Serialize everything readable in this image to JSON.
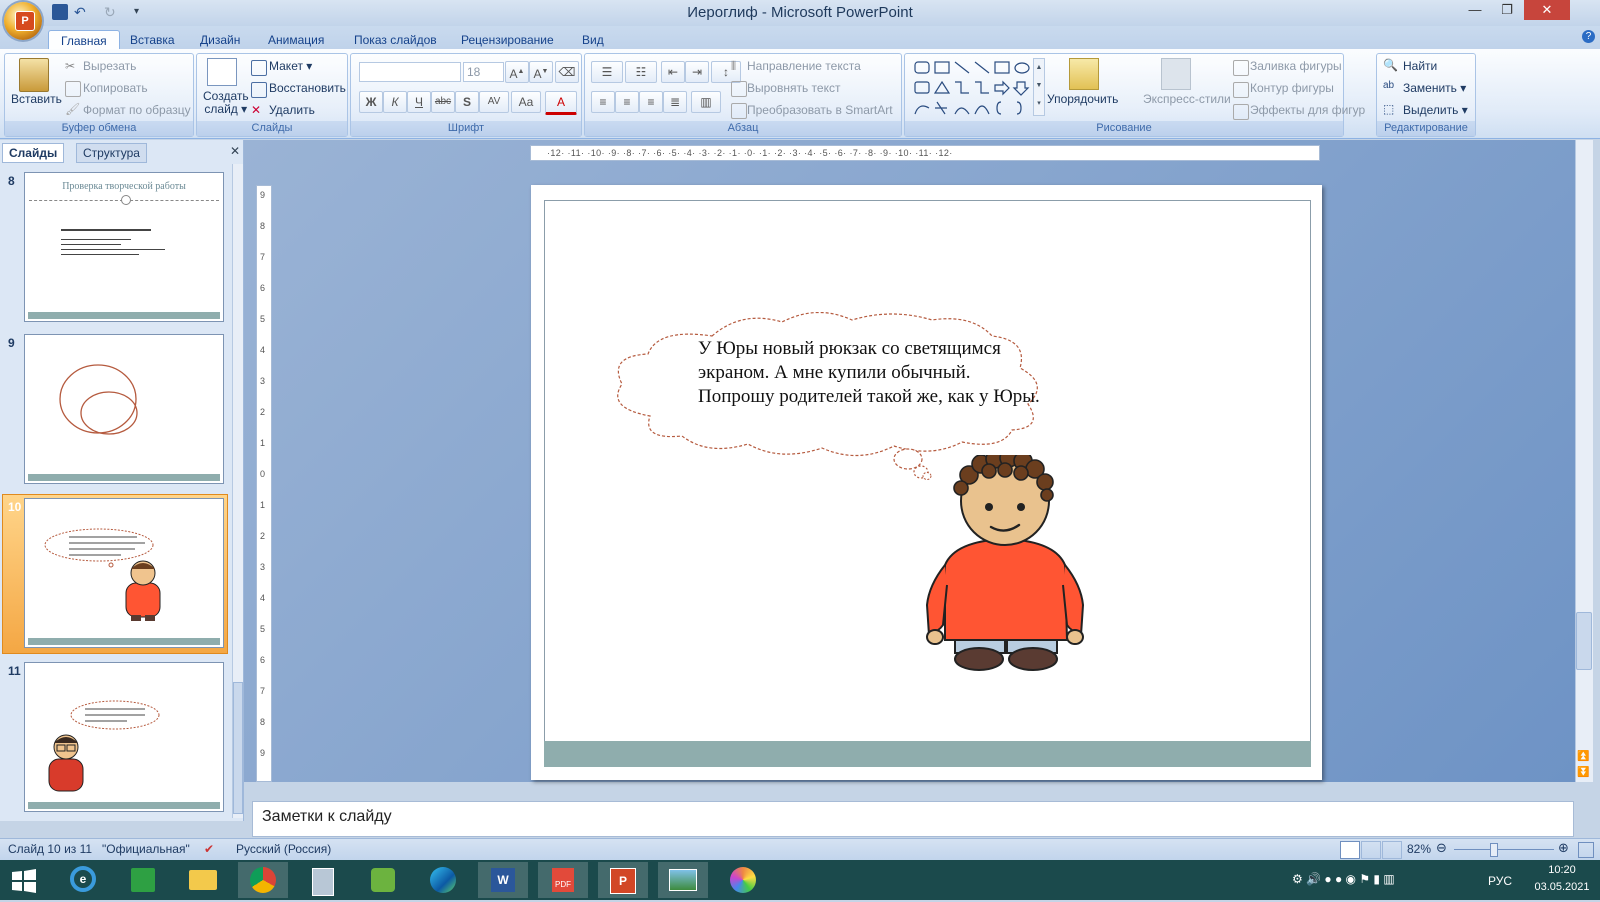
{
  "window": {
    "title": "Иероглиф - Microsoft PowerPoint"
  },
  "tabs": [
    "Главная",
    "Вставка",
    "Дизайн",
    "Анимация",
    "Показ слайдов",
    "Рецензирование",
    "Вид"
  ],
  "ribbon": {
    "clipboard": {
      "label": "Буфер обмена",
      "paste": "Вставить",
      "cut": "Вырезать",
      "copy": "Копировать",
      "format_painter": "Формат по образцу"
    },
    "slides": {
      "label": "Слайды",
      "new_slide_line1": "Создать",
      "new_slide_line2": "слайд",
      "layout": "Макет",
      "reset": "Восстановить",
      "delete": "Удалить"
    },
    "font": {
      "label": "Шрифт",
      "size": "18",
      "bold": "Ж",
      "italic": "К",
      "underline": "Ч",
      "strike": "abc",
      "shadow": "S",
      "spacing": "AV",
      "case": "Aa",
      "color": "A"
    },
    "paragraph": {
      "label": "Абзац",
      "text_direction": "Направление текста",
      "align_text": "Выровнять текст",
      "smartart": "Преобразовать в SmartArt"
    },
    "drawing": {
      "label": "Рисование",
      "arrange": "Упорядочить",
      "quick_styles": "Экспресс-стили",
      "fill": "Заливка фигуры",
      "outline": "Контур фигуры",
      "effects": "Эффекты для фигур"
    },
    "editing": {
      "label": "Редактирование",
      "find": "Найти",
      "replace": "Заменить",
      "select": "Выделить"
    }
  },
  "left_panel": {
    "tab_slides": "Слайды",
    "tab_outline": "Структура",
    "thumbs": [
      {
        "num": "8",
        "title": "Проверка творческой работы"
      },
      {
        "num": "9"
      },
      {
        "num": "10"
      },
      {
        "num": "11"
      }
    ]
  },
  "slide": {
    "cloud_text": "У Юры новый рюкзак со светящимся экраном. А мне купили обычный. Попрошу родителей такой же, как у Юры."
  },
  "notes": {
    "placeholder": "Заметки к слайду"
  },
  "status": {
    "slide": "Слайд 10 из 11",
    "theme": "\"Официальная\"",
    "language": "Русский (Россия)",
    "zoom": "82%"
  },
  "tray": {
    "lang": "РУС",
    "time": "10:20",
    "date": "03.05.2021"
  },
  "colors": {
    "accent": "#2a5ca8",
    "shirt": "#ff5533",
    "band": "#8fadad"
  }
}
